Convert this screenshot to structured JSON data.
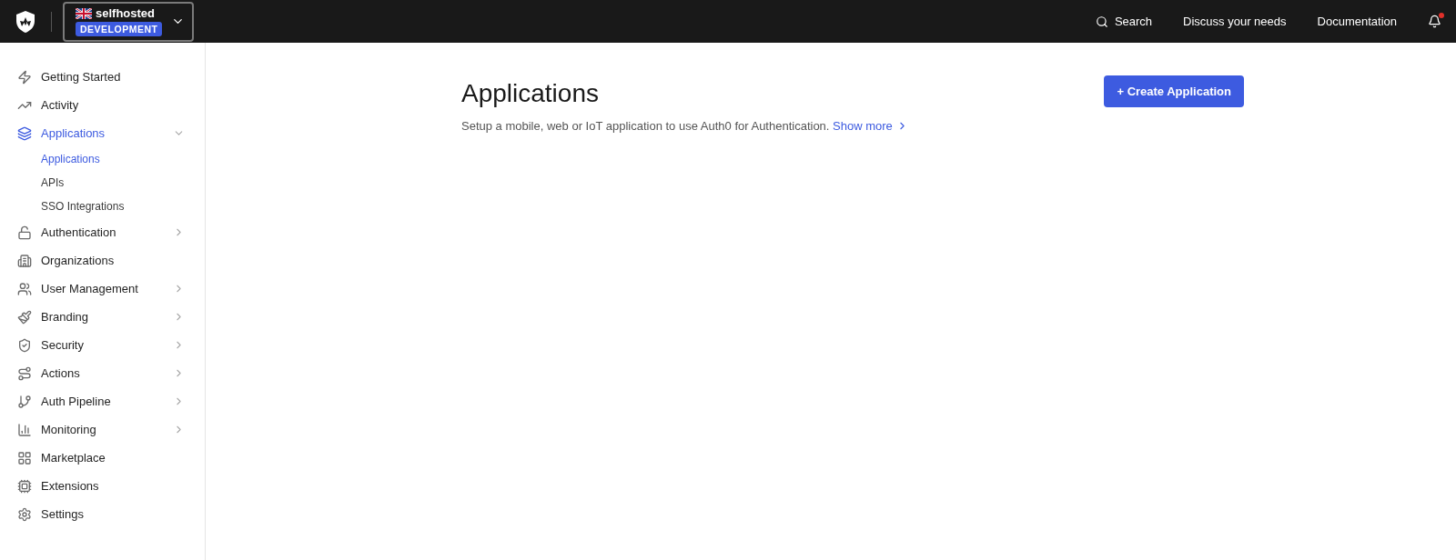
{
  "topbar": {
    "tenant": {
      "name": "selfhosted",
      "environment": "DEVELOPMENT",
      "expanded": false
    },
    "nav": [
      {
        "kind": "search",
        "label": "Search"
      },
      {
        "kind": "link",
        "label": "Discuss your needs"
      },
      {
        "kind": "link",
        "label": "Documentation"
      }
    ],
    "notifications": {
      "unread": true
    }
  },
  "sidebar": {
    "items": [
      {
        "kind": "link",
        "label": "Getting Started",
        "selected": false
      },
      {
        "kind": "link",
        "label": "Activity",
        "selected": false
      },
      {
        "kind": "group",
        "label": "Applications",
        "selected": true,
        "expanded": true,
        "children": [
          {
            "label": "Applications",
            "selected": true
          },
          {
            "label": "APIs",
            "selected": false
          },
          {
            "label": "SSO Integrations",
            "selected": false
          }
        ]
      },
      {
        "kind": "group",
        "label": "Authentication",
        "selected": false,
        "expanded": false
      },
      {
        "kind": "link",
        "label": "Organizations",
        "selected": false
      },
      {
        "kind": "group",
        "label": "User Management",
        "selected": false,
        "expanded": false
      },
      {
        "kind": "group",
        "label": "Branding",
        "selected": false,
        "expanded": false
      },
      {
        "kind": "group",
        "label": "Security",
        "selected": false,
        "expanded": false
      },
      {
        "kind": "group",
        "label": "Actions",
        "selected": false,
        "expanded": false
      },
      {
        "kind": "group",
        "label": "Auth Pipeline",
        "selected": false,
        "expanded": false
      },
      {
        "kind": "group",
        "label": "Monitoring",
        "selected": false,
        "expanded": false
      },
      {
        "kind": "link",
        "label": "Marketplace",
        "selected": false
      },
      {
        "kind": "link",
        "label": "Extensions",
        "selected": false
      },
      {
        "kind": "link",
        "label": "Settings",
        "selected": false
      }
    ]
  },
  "main": {
    "title": "Applications",
    "description": "Setup a mobile, web or IoT application to use Auth0 for Authentication.",
    "show_more": "Show more",
    "create_button": "+ Create Application"
  }
}
